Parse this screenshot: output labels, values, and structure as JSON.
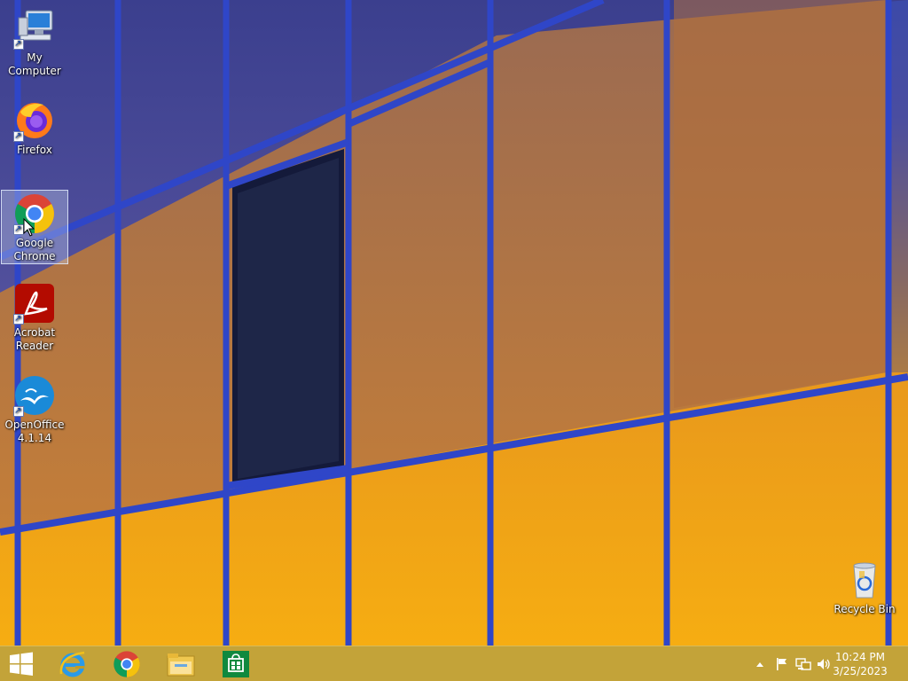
{
  "desktop": {
    "icons": [
      {
        "label": "My Computer",
        "icon": "computer-icon"
      },
      {
        "label": "Firefox",
        "icon": "firefox-icon"
      },
      {
        "label": "Google\nChrome",
        "icon": "chrome-icon"
      },
      {
        "label": "Acrobat\nReader",
        "icon": "acrobat-icon"
      },
      {
        "label": "OpenOffice\n4.1.14",
        "icon": "openoffice-icon"
      },
      {
        "label": "Recycle Bin",
        "icon": "recycle-bin-icon"
      }
    ]
  },
  "taskbar": {
    "pinned": [
      {
        "name": "Start",
        "icon": "windows-logo-icon"
      },
      {
        "name": "Internet Explorer",
        "icon": "internet-explorer-icon"
      },
      {
        "name": "Google Chrome",
        "icon": "chrome-icon"
      },
      {
        "name": "File Explorer",
        "icon": "file-explorer-icon"
      },
      {
        "name": "Store",
        "icon": "store-icon"
      }
    ],
    "tray_icons": [
      "show-hidden-icons-icon",
      "action-center-flag-icon",
      "network-icon",
      "volume-icon"
    ],
    "clock": {
      "time": "10:24 PM",
      "date": "3/25/2023"
    }
  },
  "colors": {
    "taskbar": "#be9b28",
    "wallpaper_top": "#3c4aa8",
    "wallpaper_bottom": "#f4a914",
    "frame_blue": "#2f46c8"
  }
}
